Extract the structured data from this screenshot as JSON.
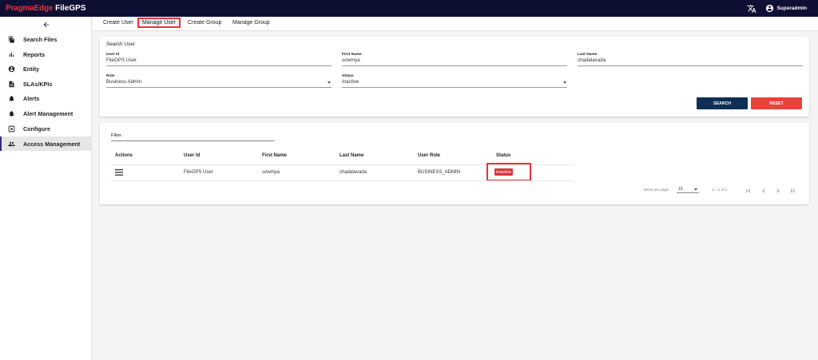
{
  "brand": {
    "part1": "PragmaEdge",
    "part2": "FileGPS"
  },
  "header": {
    "user_name": "Superadmin"
  },
  "sidebar": {
    "items": [
      {
        "label": "Search Files"
      },
      {
        "label": "Reports"
      },
      {
        "label": "Entity"
      },
      {
        "label": "SLAs/KPIs"
      },
      {
        "label": "Alerts"
      },
      {
        "label": "Alert Management"
      },
      {
        "label": "Configure"
      },
      {
        "label": "Access Management",
        "active": true
      }
    ]
  },
  "tabs": [
    {
      "label": "Create User"
    },
    {
      "label": "Manage User",
      "active": true
    },
    {
      "label": "Create Group"
    },
    {
      "label": "Manage Group"
    }
  ],
  "search": {
    "title": "Search User",
    "fields": {
      "user_id": {
        "label": "User Id",
        "value": "FileGPS User"
      },
      "first_name": {
        "label": "First Name",
        "value": "sowmya"
      },
      "last_name": {
        "label": "Last Name",
        "value": "chadalavada"
      },
      "role": {
        "label": "Role",
        "value": "Business Admin"
      },
      "status": {
        "label": "Status",
        "value": "Inactive"
      }
    },
    "search_button": "SEARCH",
    "reset_button": "RESET"
  },
  "results": {
    "filter_label": "Filter",
    "columns": [
      "Actions",
      "User Id",
      "First Name",
      "Last Name",
      "User Role",
      "Status"
    ],
    "rows": [
      {
        "user_id": "FileGPS User",
        "first_name": "sowmya",
        "last_name": "chadalavada",
        "user_role": "BUSINESS_ADMIN",
        "status": "Inactive"
      }
    ],
    "paginator": {
      "items_per_page_label": "Items per page:",
      "page_size": "10",
      "range_label": "1 – 1 of 1"
    }
  },
  "colors": {
    "topbar": "#0d1033",
    "brand_red": "#e8323c",
    "search_button": "#0f2e55",
    "reset_button": "#e8433a",
    "inactive_badge": "#d9363e",
    "highlight": "#e8323c"
  },
  "icons": {
    "back": "arrow-left-icon",
    "translate": "translate-icon",
    "user": "account-circle-icon",
    "row_actions": "menu-icon",
    "pager": [
      "first-page-icon",
      "prev-page-icon",
      "next-page-icon",
      "last-page-icon"
    ]
  }
}
